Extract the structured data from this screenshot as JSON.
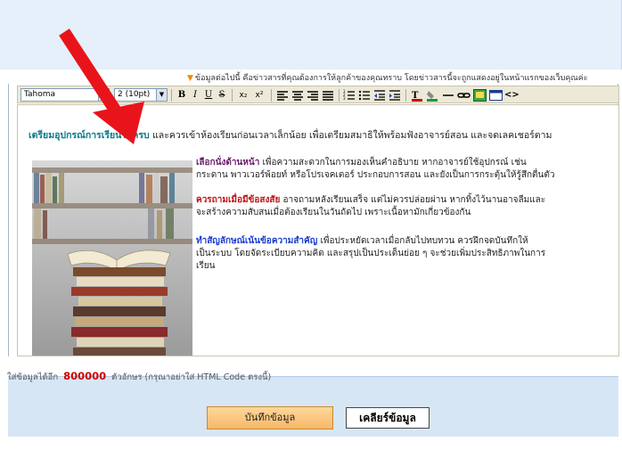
{
  "info_line": "ข้อมูลต่อไปนี้ คือข่าวสารที่คุณต้องการให้ลูกค้าของคุณทราบ โดยข่าวสารนี้จะถูกแสดงอยู่ในหน้าแรกของเว็บคุณค่ะ",
  "toolbar": {
    "font_name": "Tahoma",
    "font_size": "2 (10pt)",
    "bold": "B",
    "italic": "I",
    "underline": "U",
    "strike": "S",
    "subscript": "x₂",
    "superscript": "x²"
  },
  "editor": {
    "intro_highlight": "เตรียมอุปกรณ์การเรียนให้ครบ",
    "intro_rest": " และควรเข้าห้องเรียนก่อนเวลาเล็กน้อย เพื่อเตรียมสมาธิให้พร้อมฟังอาจารย์สอน และจดเลคเชอร์ตาม",
    "tip1_title": "เลือกนั่งด้านหน้า",
    "tip1_line1": " เพื่อความสะดวกในการมองเห็นคำอธิบาย หากอาจารย์ใช้อุปกรณ์ เช่น",
    "tip1_line2": "กระดาน พาวเวอร์พ้อยท์ หรือโปรเจคเตอร์ ประกอบการสอน และยังเป็นการกระตุ้นให้รู้สึกตื่นตัว",
    "tip2_title": "ควรถามเมื่อมีข้อสงสัย",
    "tip2_line1": " อาจถามหลังเรียนเสร็จ แต่ไม่ควรปล่อยผ่าน หากทิ้งไว้นานอาจลืมและ",
    "tip2_line2": "จะสร้างความสับสนเมื่อต้องเรียนในวันถัดไป เพราะเนื้อหามักเกี่ยวข้องกัน",
    "tip3_title": "ทำสัญลักษณ์เน้นข้อความสำคัญ",
    "tip3_line1": " เพื่อประหยัดเวลาเมื่อกลับไปทบทวน ควรฝึกจดบันทึกให้",
    "tip3_line2": "เป็นระบบ โดยจัดระเบียบความคิด และสรุปเป็นประเด็นย่อย ๆ จะช่วยเพิ่มประสิทธิภาพในการ",
    "tip3_line3": "เรียน"
  },
  "counter": {
    "prefix": "ใส่ข้อมูลได้อีก",
    "value": "800000",
    "suffix": "ตัวอักษร (กรุณาอย่าใส่ HTML Code ตรงนี้)"
  },
  "buttons": {
    "save": "บันทึกข้อมูล",
    "clear": "เคลียร์ข้อมูล"
  },
  "colors": {
    "arrow": "#e8141a",
    "highlight_teal": "#0b7a8a",
    "counter_red": "#d00000"
  }
}
